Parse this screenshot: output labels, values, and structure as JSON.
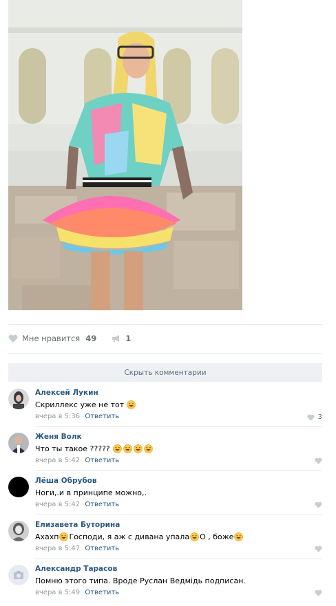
{
  "post": {
    "likes_label": "Мне нравится",
    "likes_count": "49",
    "shares_count": "1"
  },
  "hide_comments_label": "Скрыть комментарии",
  "comments": [
    {
      "name": "Алексей Лукин",
      "text_parts": [
        "Скриллекс уже не тот",
        ""
      ],
      "time": "вчера в 5:36",
      "reply": "Ответить",
      "likes": "3"
    },
    {
      "name": "Женя Волк",
      "text_parts": [
        "Что ты такое ?????"
      ],
      "time": "вчера в 5:42",
      "reply": "Ответить",
      "likes": ""
    },
    {
      "name": "Лёша Обрубов",
      "text_parts": [
        "Ноги,.и в принципе можно,."
      ],
      "time": "вчера в 5:42",
      "reply": "Ответить",
      "likes": ""
    },
    {
      "name": "Елизавета Буторина",
      "text_parts": [
        "Ахахп",
        " Господи, я аж с дивана упала",
        " О , боже"
      ],
      "time": "вчера в 5:47",
      "reply": "Ответить",
      "likes": ""
    },
    {
      "name": "Александр Тарасов",
      "text_parts": [
        "Помню этого типа. Вроде Руслан Ведмідь подписан."
      ],
      "time": "вчера в 5:49",
      "reply": "Ответить",
      "likes": ""
    }
  ],
  "colors": {
    "link": "#2a5885",
    "muted": "#939aa3",
    "hide_bar_bg": "#eef0f3"
  }
}
